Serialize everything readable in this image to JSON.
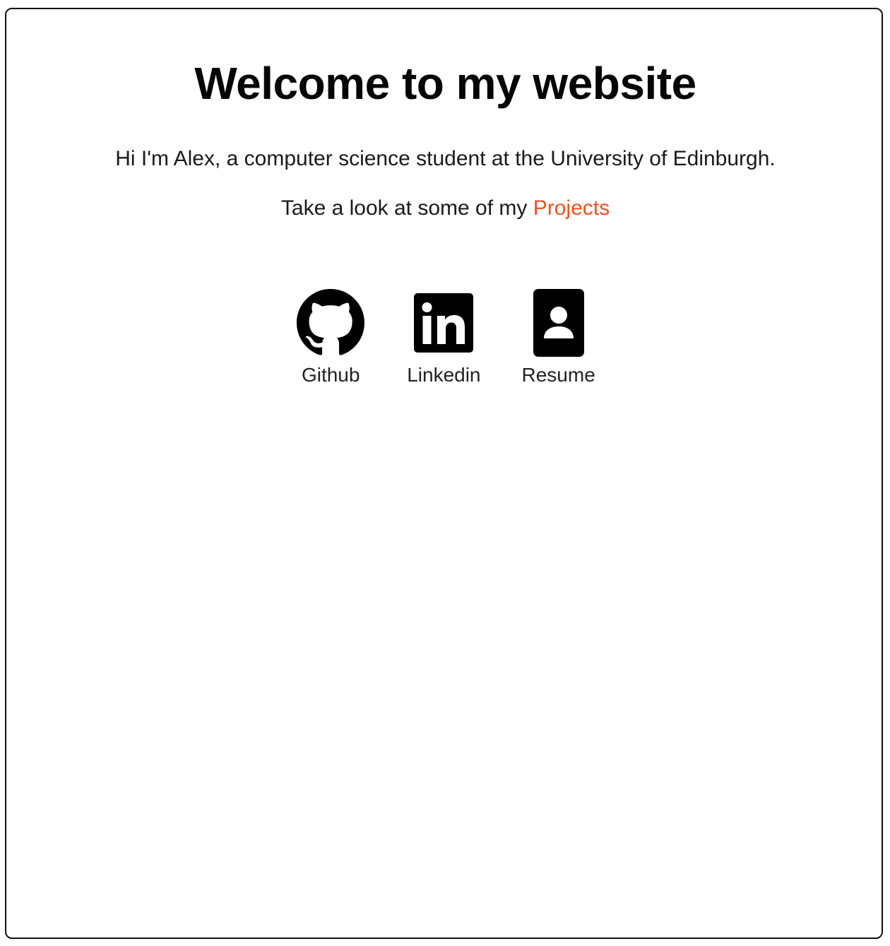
{
  "page": {
    "headline": "Welcome to my website",
    "intro": "Hi I'm Alex, a computer science student at the University of Edinburgh.",
    "projects_prefix": "Take a look at some of my ",
    "projects_link": "Projects"
  },
  "links": {
    "github": {
      "label": "Github",
      "icon": "github-icon"
    },
    "linkedin": {
      "label": "Linkedin",
      "icon": "linkedin-icon"
    },
    "resume": {
      "label": "Resume",
      "icon": "resume-icon"
    }
  },
  "colors": {
    "accent": "#f0501e",
    "text": "#111111",
    "background": "#ffffff"
  }
}
